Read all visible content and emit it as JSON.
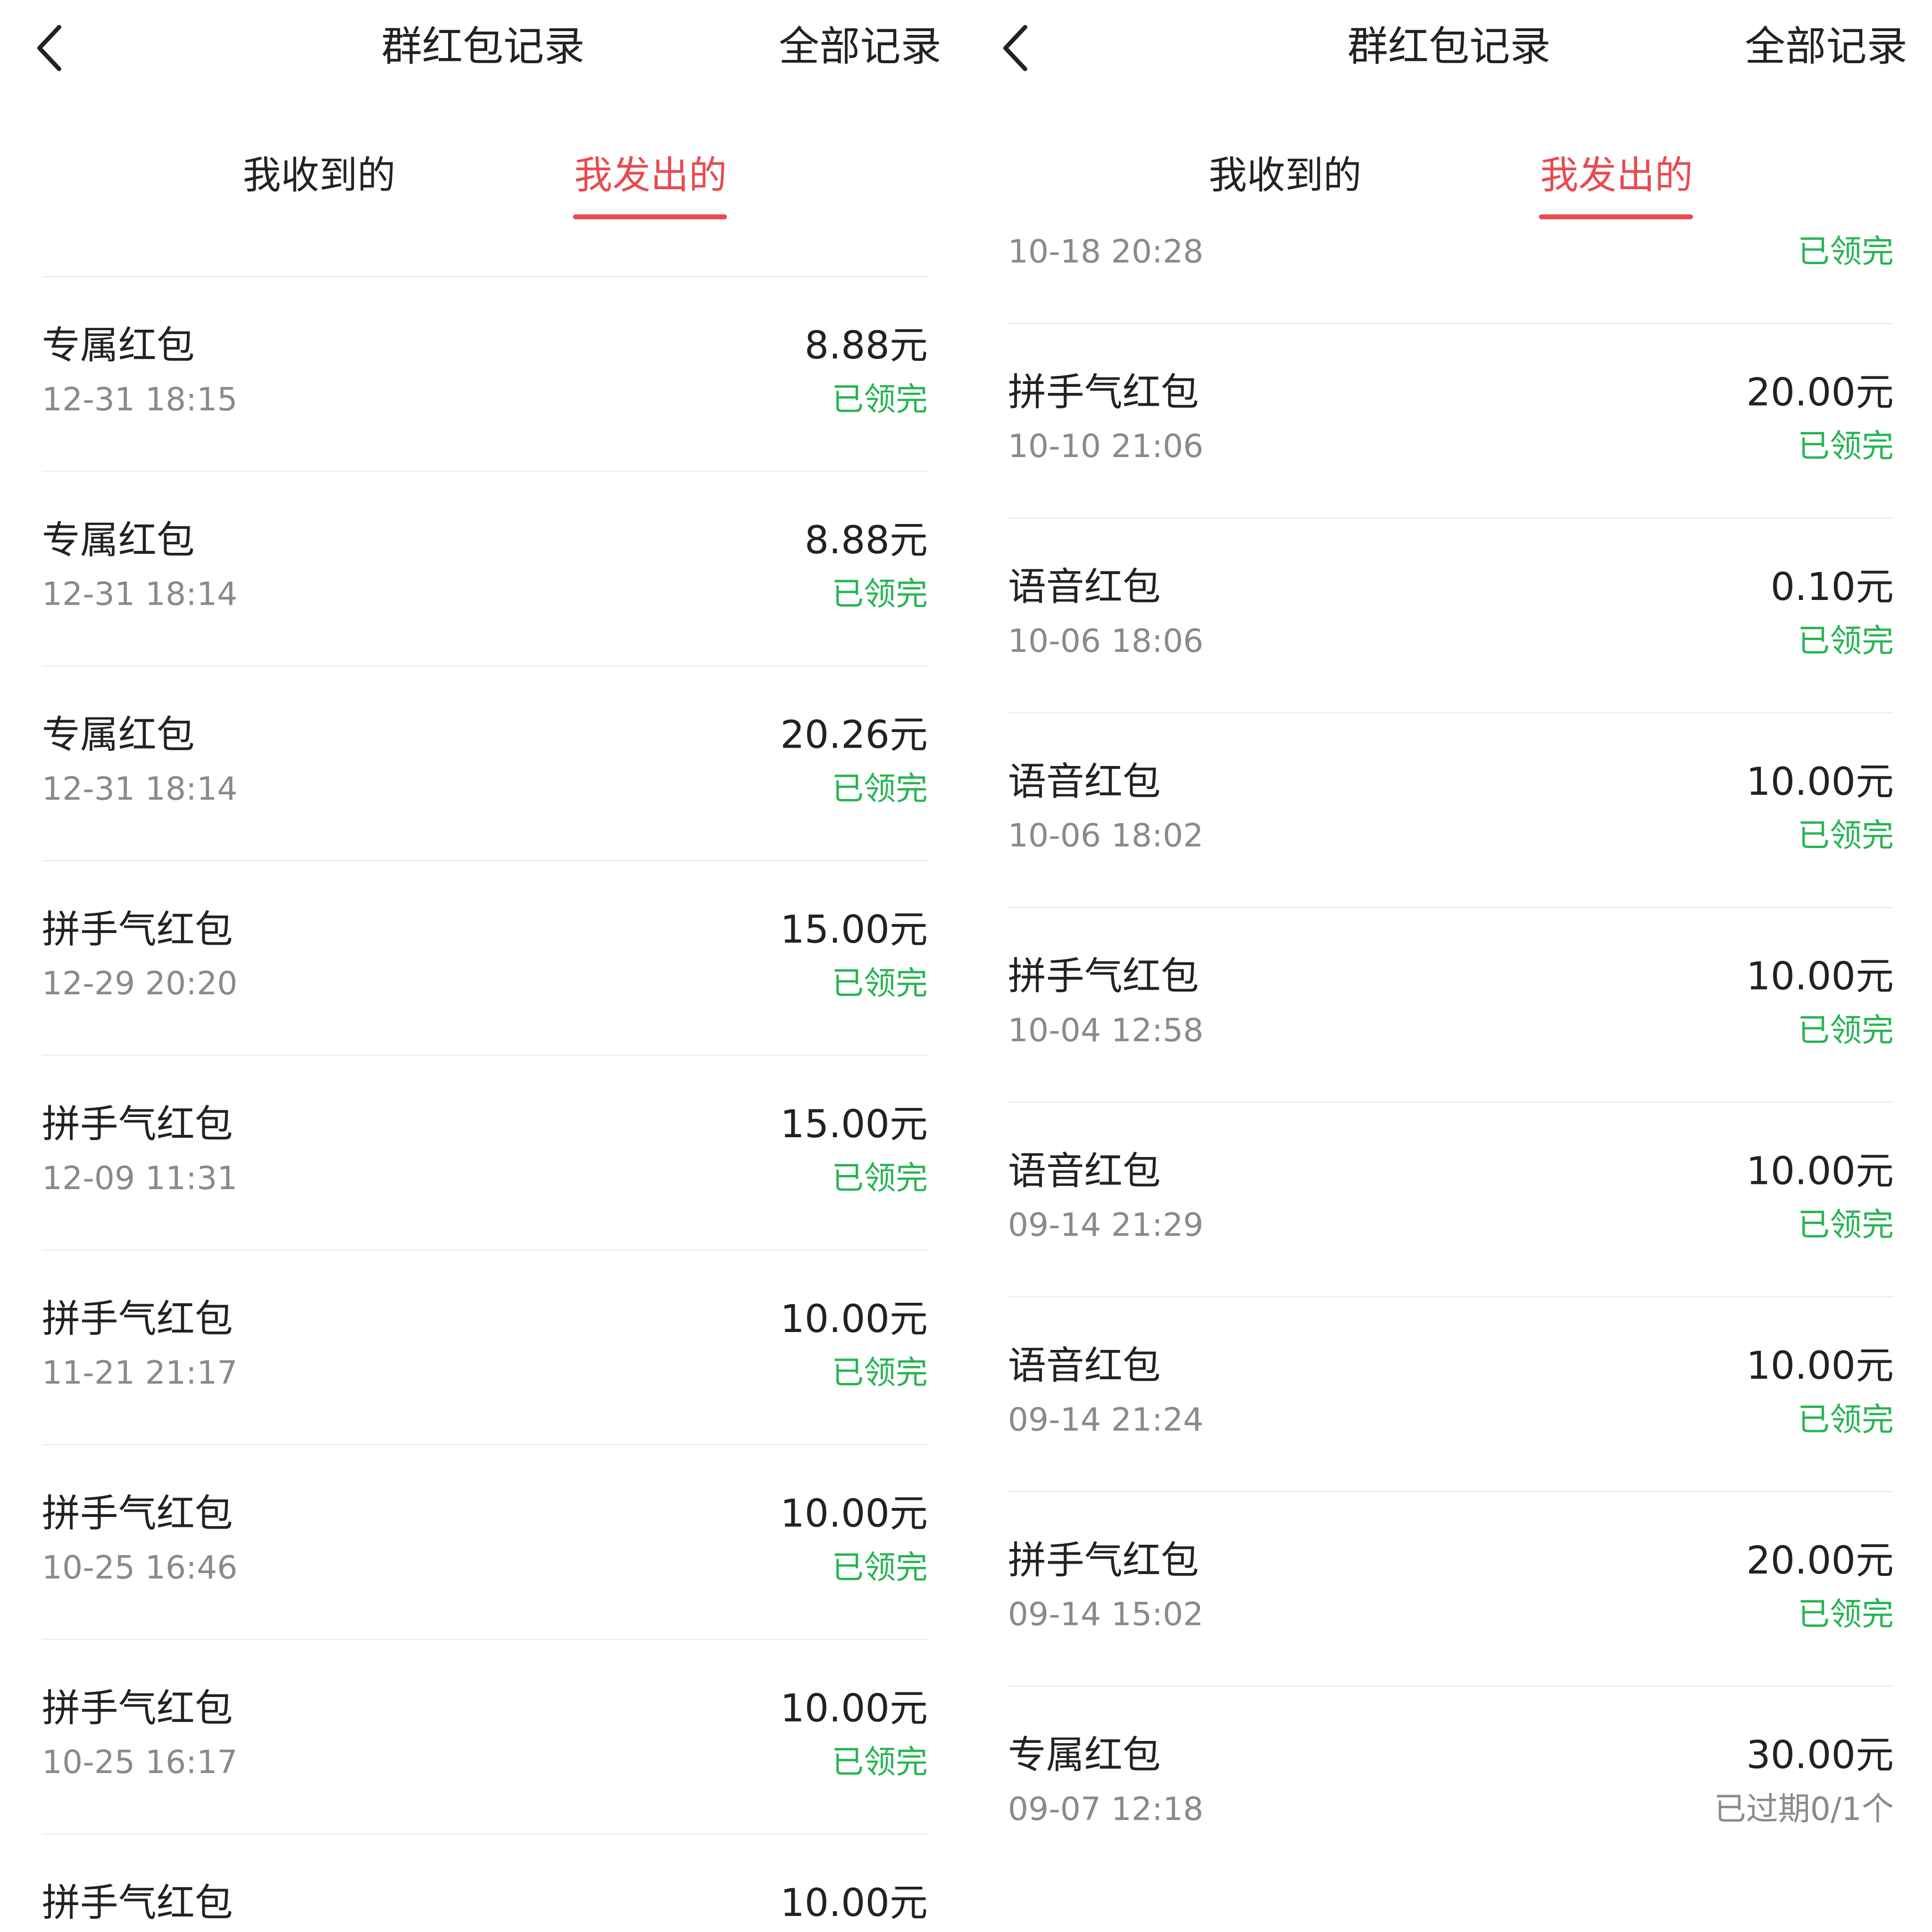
{
  "left": {
    "header": {
      "title": "群红包记录",
      "all_records_label": "全部记录"
    },
    "tabs": [
      {
        "label": "我收到的",
        "active": false
      },
      {
        "label": "我发出的",
        "active": true
      }
    ],
    "items": [
      {
        "name": "专属红包",
        "time": "12-31 18:15",
        "amount": "8.88元",
        "status": "已领完",
        "status_type": "done"
      },
      {
        "name": "专属红包",
        "time": "12-31 18:14",
        "amount": "8.88元",
        "status": "已领完",
        "status_type": "done"
      },
      {
        "name": "专属红包",
        "time": "12-31 18:14",
        "amount": "20.26元",
        "status": "已领完",
        "status_type": "done"
      },
      {
        "name": "拼手气红包",
        "time": "12-29 20:20",
        "amount": "15.00元",
        "status": "已领完",
        "status_type": "done"
      },
      {
        "name": "拼手气红包",
        "time": "12-09 11:31",
        "amount": "15.00元",
        "status": "已领完",
        "status_type": "done"
      },
      {
        "name": "拼手气红包",
        "time": "11-21 21:17",
        "amount": "10.00元",
        "status": "已领完",
        "status_type": "done"
      },
      {
        "name": "拼手气红包",
        "time": "10-25 16:46",
        "amount": "10.00元",
        "status": "已领完",
        "status_type": "done"
      },
      {
        "name": "拼手气红包",
        "time": "10-25 16:17",
        "amount": "10.00元",
        "status": "已领完",
        "status_type": "done"
      },
      {
        "name": "拼手气红包",
        "time": "",
        "amount": "10.00元",
        "status": "",
        "status_type": "done"
      }
    ]
  },
  "right": {
    "header": {
      "title": "群红包记录",
      "all_records_label": "全部记录"
    },
    "tabs": [
      {
        "label": "我收到的",
        "active": false
      },
      {
        "label": "我发出的",
        "active": true
      }
    ],
    "items": [
      {
        "name": "",
        "time": "10-18 20:28",
        "amount": "",
        "status": "已领完",
        "status_type": "done"
      },
      {
        "name": "拼手气红包",
        "time": "10-10 21:06",
        "amount": "20.00元",
        "status": "已领完",
        "status_type": "done"
      },
      {
        "name": "语音红包",
        "time": "10-06 18:06",
        "amount": "0.10元",
        "status": "已领完",
        "status_type": "done"
      },
      {
        "name": "语音红包",
        "time": "10-06 18:02",
        "amount": "10.00元",
        "status": "已领完",
        "status_type": "done"
      },
      {
        "name": "拼手气红包",
        "time": "10-04 12:58",
        "amount": "10.00元",
        "status": "已领完",
        "status_type": "done"
      },
      {
        "name": "语音红包",
        "time": "09-14 21:29",
        "amount": "10.00元",
        "status": "已领完",
        "status_type": "done"
      },
      {
        "name": "语音红包",
        "time": "09-14 21:24",
        "amount": "10.00元",
        "status": "已领完",
        "status_type": "done"
      },
      {
        "name": "拼手气红包",
        "time": "09-14 15:02",
        "amount": "20.00元",
        "status": "已领完",
        "status_type": "done"
      },
      {
        "name": "专属红包",
        "time": "09-07 12:18",
        "amount": "30.00元",
        "status": "已过期0/1个",
        "status_type": "expired"
      }
    ]
  },
  "colors": {
    "accent_red": "#e84b51",
    "status_green": "#27b552",
    "muted_gray": "#8a8a8a",
    "text": "#222222"
  }
}
